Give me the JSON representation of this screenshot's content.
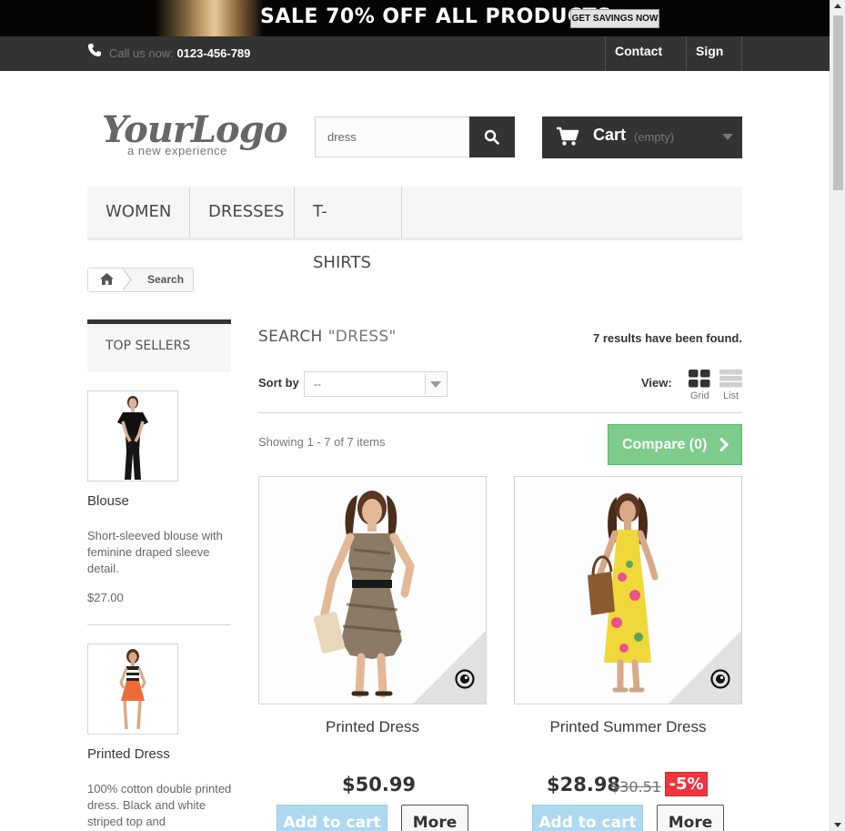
{
  "banner": {
    "text": "SALE 70% OFF ALL PRODUCTS",
    "button": "GET SAVINGS NOW"
  },
  "topnav": {
    "call_prefix": "Call us now:",
    "phone": "0123-456-789",
    "contact": "Contact us",
    "signin": "Sign in"
  },
  "logo": {
    "main": "YourLogo",
    "tagline": "a new experience"
  },
  "search": {
    "value": "dress"
  },
  "cart": {
    "label": "Cart",
    "status": "(empty)"
  },
  "menu": {
    "items": [
      "Women",
      "Dresses",
      "T-shirts"
    ]
  },
  "breadcrumb": {
    "current": "Search"
  },
  "sidebar": {
    "title": "Top sellers",
    "products": [
      {
        "name": "Blouse",
        "description": "Short-sleeved blouse with feminine draped sleeve detail.",
        "price": "$27.00"
      },
      {
        "name": "Printed Dress",
        "description": "100% cotton double printed dress. Black and white striped top and"
      }
    ]
  },
  "main": {
    "heading": "Search",
    "query": "\"dress\"",
    "results": "7 results have been found.",
    "sort_label": "Sort by",
    "sort_value": "--",
    "view_label": "View:",
    "view_grid": "Grid",
    "view_list": "List",
    "showing": "Showing 1 - 7 of 7 items",
    "compare": "Compare (0)"
  },
  "products": [
    {
      "name": "Printed Dress",
      "price": "$50.99",
      "add_label": "Add to cart",
      "more_label": "More"
    },
    {
      "name": "Printed Summer Dress",
      "price": "$28.98",
      "old_price": "$30.51",
      "discount": "-5%",
      "add_label": "Add to cart",
      "more_label": "More"
    }
  ],
  "colors": {
    "accent_green": "#7dcc8b",
    "dark": "#333333",
    "discount_red": "#f13340",
    "add_blue": "#add8f0"
  }
}
